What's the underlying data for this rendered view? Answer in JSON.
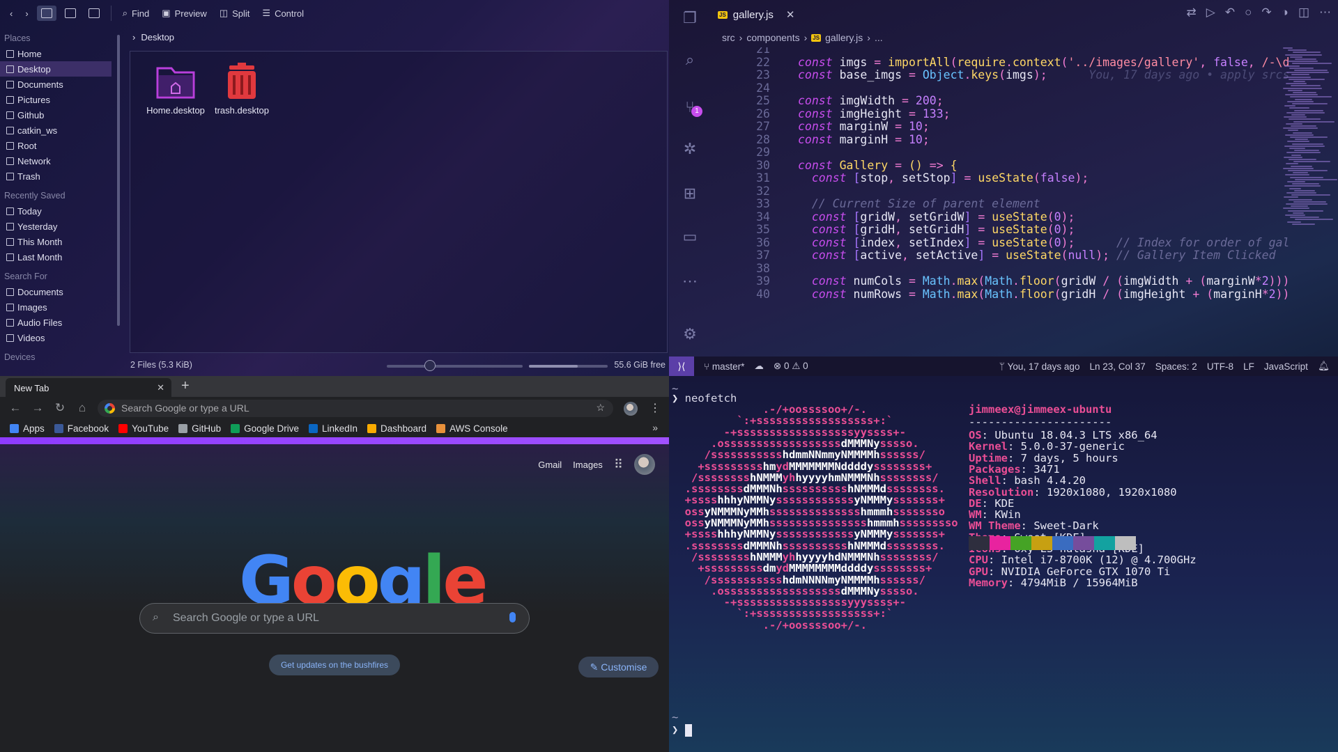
{
  "file_manager": {
    "toolbar": {
      "find": "Find",
      "preview": "Preview",
      "split": "Split",
      "control": "Control"
    },
    "breadcrumb": "Desktop",
    "sidebar": {
      "places_heading": "Places",
      "places": [
        "Home",
        "Desktop",
        "Documents",
        "Pictures",
        "Github",
        "catkin_ws",
        "Root",
        "Network",
        "Trash"
      ],
      "recent_heading": "Recently Saved",
      "recent": [
        "Today",
        "Yesterday",
        "This Month",
        "Last Month"
      ],
      "search_heading": "Search For",
      "search": [
        "Documents",
        "Images",
        "Audio Files",
        "Videos"
      ],
      "devices_heading": "Devices"
    },
    "files": [
      "Home.desktop",
      "trash.desktop"
    ],
    "status": {
      "count": "2 Files (5.3 KiB)",
      "free": "55.6 GiB free",
      "zoom_fraction": 0.3,
      "free_fraction": 0.62
    }
  },
  "editor": {
    "tab_title": "gallery.js",
    "breadcrumb": [
      "src",
      "components",
      "gallery.js",
      "..."
    ],
    "scm_badge": "1",
    "lines": [
      {
        "n": "21",
        "html": ""
      },
      {
        "n": "22",
        "html": "<span class='k'>const</span> <span class='v'>imgs</span> <span class='p'>=</span> <span class='f'>importAll</span><span class='p'>(</span><span class='f'>require</span><span class='p'>.</span><span class='f'>context</span><span class='p'>(</span><span class='s'>'../images/gallery'</span><span class='p'>,</span> <span class='n'>false</span><span class='p'>,</span> <span class='s'>/-\\d</span>"
      },
      {
        "n": "23",
        "html": "<span class='k'>const</span> <span class='v'>base_imgs</span> <span class='p'>=</span> <span class='t'>Object</span><span class='p'>.</span><span class='f'>keys</span><span class='p'>(</span><span class='v'>imgs</span><span class='p'>);</span>      <span class='cm' style='opacity:.6'>You, 17 days ago • apply srcs</span>"
      },
      {
        "n": "24",
        "html": ""
      },
      {
        "n": "25",
        "html": "<span class='k'>const</span> <span class='v'>imgWidth</span> <span class='p'>=</span> <span class='n'>200</span><span class='p'>;</span>"
      },
      {
        "n": "26",
        "html": "<span class='k'>const</span> <span class='v'>imgHeight</span> <span class='p'>=</span> <span class='n'>133</span><span class='p'>;</span>"
      },
      {
        "n": "27",
        "html": "<span class='k'>const</span> <span class='v'>marginW</span> <span class='p'>=</span> <span class='n'>10</span><span class='p'>;</span>"
      },
      {
        "n": "28",
        "html": "<span class='k'>const</span> <span class='v'>marginH</span> <span class='p'>=</span> <span class='n'>10</span><span class='p'>;</span>"
      },
      {
        "n": "29",
        "html": ""
      },
      {
        "n": "30",
        "html": "<span class='k'>const</span> <span class='f'>Gallery</span> <span class='p'>=</span> <span class='f'>()</span> <span class='p'>=&gt;</span> <span class='f'>{</span>"
      },
      {
        "n": "31",
        "html": "  <span class='k'>const</span> <span class='bl'>[</span><span class='v'>stop</span><span class='p'>,</span> <span class='v'>setStop</span><span class='bl'>]</span> <span class='p'>=</span> <span class='f'>useState</span><span class='p'>(</span><span class='n'>false</span><span class='p'>);</span>"
      },
      {
        "n": "32",
        "html": ""
      },
      {
        "n": "33",
        "html": "  <span class='cm'>// Current Size of parent element</span>"
      },
      {
        "n": "34",
        "html": "  <span class='k'>const</span> <span class='bl'>[</span><span class='v'>gridW</span><span class='p'>,</span> <span class='v'>setGridW</span><span class='bl'>]</span> <span class='p'>=</span> <span class='f'>useState</span><span class='p'>(</span><span class='n'>0</span><span class='p'>);</span>"
      },
      {
        "n": "35",
        "html": "  <span class='k'>const</span> <span class='bl'>[</span><span class='v'>gridH</span><span class='p'>,</span> <span class='v'>setGridH</span><span class='bl'>]</span> <span class='p'>=</span> <span class='f'>useState</span><span class='p'>(</span><span class='n'>0</span><span class='p'>);</span>"
      },
      {
        "n": "36",
        "html": "  <span class='k'>const</span> <span class='bl'>[</span><span class='v'>index</span><span class='p'>,</span> <span class='v'>setIndex</span><span class='bl'>]</span> <span class='p'>=</span> <span class='f'>useState</span><span class='p'>(</span><span class='n'>0</span><span class='p'>);</span>      <span class='cm'>// Index for order of gal</span>"
      },
      {
        "n": "37",
        "html": "  <span class='k'>const</span> <span class='bl'>[</span><span class='v'>active</span><span class='p'>,</span> <span class='v'>setActive</span><span class='bl'>]</span> <span class='p'>=</span> <span class='f'>useState</span><span class='p'>(</span><span class='n'>null</span><span class='p'>);</span> <span class='cm'>// Gallery Item Clicked</span>"
      },
      {
        "n": "38",
        "html": ""
      },
      {
        "n": "39",
        "html": "  <span class='k'>const</span> <span class='v'>numCols</span> <span class='p'>=</span> <span class='t'>Math</span><span class='p'>.</span><span class='f'>max</span><span class='p'>(</span><span class='t'>Math</span><span class='p'>.</span><span class='f'>floor</span><span class='p'>(</span><span class='v'>gridW</span> <span class='p'>/</span> <span class='p'>(</span><span class='v'>imgWidth</span> <span class='p'>+</span> <span class='p'>(</span><span class='v'>marginW</span><span class='p'>*</span><span class='n'>2</span><span class='p'>))))</span>"
      },
      {
        "n": "40",
        "html": "  <span class='k'>const</span> <span class='v'>numRows</span> <span class='p'>=</span> <span class='t'>Math</span><span class='p'>.</span><span class='f'>max</span><span class='p'>(</span><span class='t'>Math</span><span class='p'>.</span><span class='f'>floor</span><span class='p'>(</span><span class='v'>gridH</span> <span class='p'>/</span> <span class='p'>(</span><span class='v'>imgHeight</span> <span class='p'>+</span> <span class='p'>(</span><span class='v'>marginH</span><span class='p'>*</span><span class='n'>2</span><span class='p'>))))</span>"
      }
    ],
    "status": {
      "branch": "master*",
      "errors": "0",
      "warnings": "0",
      "blame": "You, 17 days ago",
      "position": "Ln 23, Col 37",
      "spaces": "Spaces: 2",
      "encoding": "UTF-8",
      "eol": "LF",
      "language": "JavaScript"
    }
  },
  "chrome": {
    "tab_title": "New Tab",
    "omnibox_placeholder": "Search Google or type a URL",
    "bookmarks": [
      {
        "label": "Apps",
        "color": "#4285f4"
      },
      {
        "label": "Facebook",
        "color": "#3b5998"
      },
      {
        "label": "YouTube",
        "color": "#ff0000"
      },
      {
        "label": "GitHub",
        "color": "#9aa0a6"
      },
      {
        "label": "Google Drive",
        "color": "#0f9d58"
      },
      {
        "label": "LinkedIn",
        "color": "#0a66c2"
      },
      {
        "label": "Dashboard",
        "color": "#f9ab00"
      },
      {
        "label": "AWS Console",
        "color": "#e8913b"
      }
    ],
    "gmail": "Gmail",
    "images": "Images",
    "search_placeholder": "Search Google or type a URL",
    "promo": "Get updates on the bushfires",
    "customise": "Customise"
  },
  "terminal": {
    "prompt_tilde": "~",
    "command": "neofetch",
    "art": [
      "              .-/+oossssoo+/-.",
      "          `:+ssssssssssssssssss+:`",
      "        -+ssssssssssssssssssyyssss+-",
      "      .ossssssssssssssssss<b>dMMMNy</b>sssso.",
      "     /sssssssssss<b>hdmmNNmmyNMMMMh</b>ssssss/",
      "    +sssssssss<b>hm</b>yd<b>MMMMMMMNddddy</b>ssssssss+",
      "   /ssssssss<b>hNMMM</b>yh<b>hyyyyhmNMMMNh</b>ssssssss/",
      "  .ssssssss<b>dMMMNh</b>ssssssssss<b>hNMMMd</b>ssssssss.",
      "  +ssss<b>hhhyNMMNy</b>ssssssssssss<b>yNMMMy</b>sssssss+",
      "  oss<b>yNMMMNyMMh</b>ssssssssssssss<b>hmmmh</b>ssssssso",
      "  oss<b>yNMMMNyMMh</b>sssssssssssssss<b>hmmmh</b>sssssssso",
      "  +ssss<b>hhhyNMMNy</b>ssssssssssss<b>yNMMMy</b>sssssss+",
      "  .ssssssss<b>dMMMNh</b>ssssssssss<b>hNMMMd</b>ssssssss.",
      "   /ssssssss<b>hNMMM</b>yh<b>hyyyyhdNMMMNh</b>ssssssss/",
      "    +sssssssss<b>dm</b>yd<b>MMMMMMMMddddy</b>ssssssss+",
      "     /sssssssssss<b>hdmNNNNmyNMMMMh</b>ssssss/",
      "      .ossssssssssssssssss<b>dMMMNy</b>sssso.",
      "        -+sssssssssssssssssyyyssss+-",
      "          `:+ssssssssssssssssss+:`",
      "              .-/+oossssoo+/-."
    ],
    "userhost": "jimmeex@jimmeex-ubuntu",
    "separator": "----------------------",
    "info": [
      {
        "k": "OS",
        "v": "Ubuntu 18.04.3 LTS x86_64"
      },
      {
        "k": "Kernel",
        "v": "5.0.0-37-generic"
      },
      {
        "k": "Uptime",
        "v": "7 days, 5 hours"
      },
      {
        "k": "Packages",
        "v": "3471"
      },
      {
        "k": "Shell",
        "v": "bash 4.4.20"
      },
      {
        "k": "Resolution",
        "v": "1920x1080, 1920x1080"
      },
      {
        "k": "DE",
        "v": "KDE"
      },
      {
        "k": "WM",
        "v": "KWin"
      },
      {
        "k": "WM Theme",
        "v": "Sweet-Dark"
      },
      {
        "k": "Theme",
        "v": "Sweet [KDE]"
      },
      {
        "k": "Icons",
        "v": "Oxy L3 natasha [KDE]"
      },
      {
        "k": "CPU",
        "v": "Intel i7-8700K (12) @ 4.700GHz"
      },
      {
        "k": "GPU",
        "v": "NVIDIA GeForce GTX 1070 Ti"
      },
      {
        "k": "Memory",
        "v": "4794MiB / 15964MiB"
      }
    ],
    "palette": [
      "#2e2e3e",
      "#e8239f",
      "#45a325",
      "#c7a012",
      "#3a6cc0",
      "#764d9c",
      "#13a2a0",
      "#bebebe"
    ]
  }
}
